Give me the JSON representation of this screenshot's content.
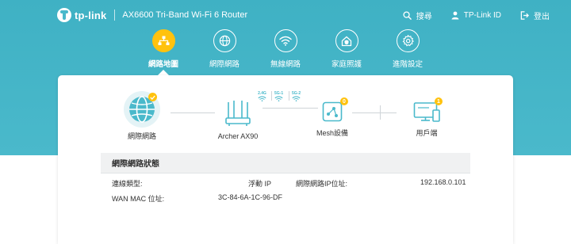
{
  "header": {
    "brand": "tp-link",
    "model": "AX6600 Tri-Band Wi-Fi 6 Router",
    "search_label": "搜尋",
    "account_label": "TP-Link ID",
    "logout_label": "登出"
  },
  "nav": {
    "items": [
      {
        "label": "網路地圖",
        "icon": "network-map-icon",
        "active": true
      },
      {
        "label": "網際網路",
        "icon": "globe-icon",
        "active": false
      },
      {
        "label": "無線網路",
        "icon": "wifi-icon",
        "active": false
      },
      {
        "label": "家庭照護",
        "icon": "home-shield-icon",
        "active": false
      },
      {
        "label": "進階設定",
        "icon": "gear-icon",
        "active": false
      }
    ]
  },
  "topology": {
    "internet_label": "網際網路",
    "router_label": "Archer AX90",
    "bands": [
      "2.4G",
      "5G-1",
      "5G-2"
    ],
    "mesh_label": "Mesh設備",
    "mesh_count": "0",
    "clients_label": "用戶端",
    "clients_count": "1"
  },
  "status": {
    "title": "網際網路狀態",
    "conn_type_label": "連線類型:",
    "conn_type_value": "浮動 IP",
    "ip_label": "網際網路IP位址:",
    "ip_value": "192.168.0.101",
    "mac_label": "WAN MAC 位址:",
    "mac_value": "3C-84-6A-1C-96-DF"
  },
  "colors": {
    "accent": "#4ab9cb",
    "active": "#ffc20e",
    "badge": "#ffc20e"
  }
}
